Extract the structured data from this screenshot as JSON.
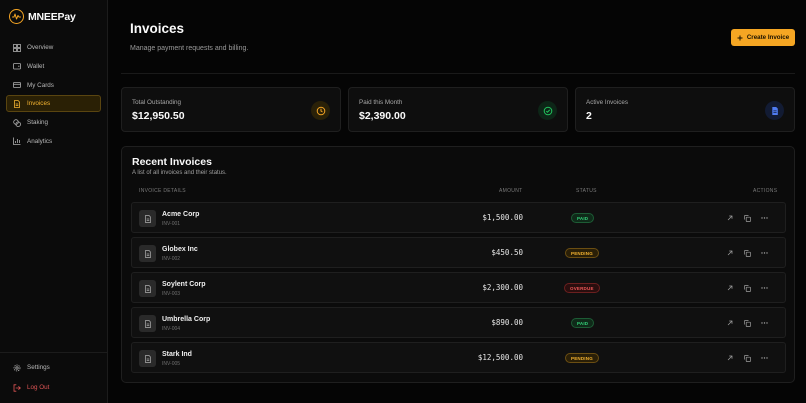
{
  "app": {
    "name": "MNEEPay"
  },
  "sidebar": {
    "items": [
      {
        "label": "Overview",
        "icon": "grid-icon"
      },
      {
        "label": "Wallet",
        "icon": "wallet-icon"
      },
      {
        "label": "My Cards",
        "icon": "credit-card-icon"
      },
      {
        "label": "Invoices",
        "icon": "invoice-icon",
        "active": true
      },
      {
        "label": "Staking",
        "icon": "coins-icon"
      },
      {
        "label": "Analytics",
        "icon": "bar-chart-icon"
      }
    ],
    "bottom": [
      {
        "label": "Settings",
        "icon": "gear-icon"
      },
      {
        "label": "Log Out",
        "icon": "logout-icon"
      }
    ]
  },
  "header": {
    "title": "Invoices",
    "subtitle": "Manage payment requests and billing.",
    "create_label": "Create Invoice"
  },
  "stats": [
    {
      "label": "Total Outstanding",
      "value": "$12,950.50",
      "icon": "clock-icon",
      "color": "#f5a524"
    },
    {
      "label": "Paid this Month",
      "value": "$2,390.00",
      "icon": "check-circle-icon",
      "color": "#22c55e"
    },
    {
      "label": "Active Invoices",
      "value": "2",
      "icon": "document-icon",
      "color": "#4f7bf0"
    }
  ],
  "recent": {
    "title": "Recent Invoices",
    "subtitle": "A list of all invoices and their status.",
    "columns": {
      "details": "Invoice Details",
      "amount": "Amount",
      "status": "Status",
      "actions": "Actions"
    },
    "rows": [
      {
        "client": "Acme Corp",
        "id": "INV-001",
        "amount": "$1,500.00",
        "status": "PAID",
        "status_kind": "paid"
      },
      {
        "client": "Globex Inc",
        "id": "INV-002",
        "amount": "$450.50",
        "status": "PENDING",
        "status_kind": "pending"
      },
      {
        "client": "Soylent Corp",
        "id": "INV-003",
        "amount": "$2,300.00",
        "status": "OVERDUE",
        "status_kind": "overdue"
      },
      {
        "client": "Umbrella Corp",
        "id": "INV-004",
        "amount": "$890.00",
        "status": "PAID",
        "status_kind": "paid"
      },
      {
        "client": "Stark Ind",
        "id": "INV-005",
        "amount": "$12,500.00",
        "status": "PENDING",
        "status_kind": "pending"
      }
    ]
  },
  "colors": {
    "accent": "#f5a623",
    "background": "#050505",
    "paid": "#34d27a",
    "pending": "#f5b431",
    "overdue": "#f05858"
  }
}
